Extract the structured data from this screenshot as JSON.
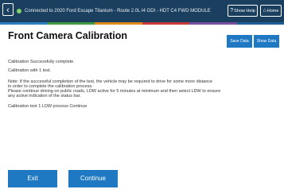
{
  "topbar": {
    "back_icon": "chevron-left-icon",
    "status_icon": "connection-dot-icon",
    "connection_text": "Connected to 2020 Ford Escape Titanium - Route 2.0L I4 GDI - HDT C4 FWD MODULE",
    "help_label": "Show Help",
    "home_label": "Home",
    "help_icon": "help-icon",
    "home_icon": "home-icon"
  },
  "colors": {
    "topbar": "#1b3f5e",
    "accent": "#1f79c2",
    "stripe": [
      "#2a7fc0",
      "#3f9a40",
      "#e08a1e",
      "#c73a3a",
      "#7a4fa0",
      "#1f5f99"
    ]
  },
  "header": {
    "title": "Front Camera Calibration",
    "buttons": [
      "Save Data",
      "Show Data"
    ]
  },
  "content": {
    "status": "Calibration Successfully complete.",
    "subtitle": "Calibration with 1 test.",
    "note_lines": [
      "Note: If the successful completion of the test, the vehicle may be required to drive for some more distance",
      "in order to complete the calibration process.",
      "Please continue driving on public roads, LDW active for 5 minutes at minimum and then select LDW to ensure",
      "any active indication of the status bar."
    ],
    "footer_line": "Calibration test 1 LDW process Continue"
  },
  "actions": {
    "exit_label": "Exit",
    "continue_label": "Continue"
  }
}
